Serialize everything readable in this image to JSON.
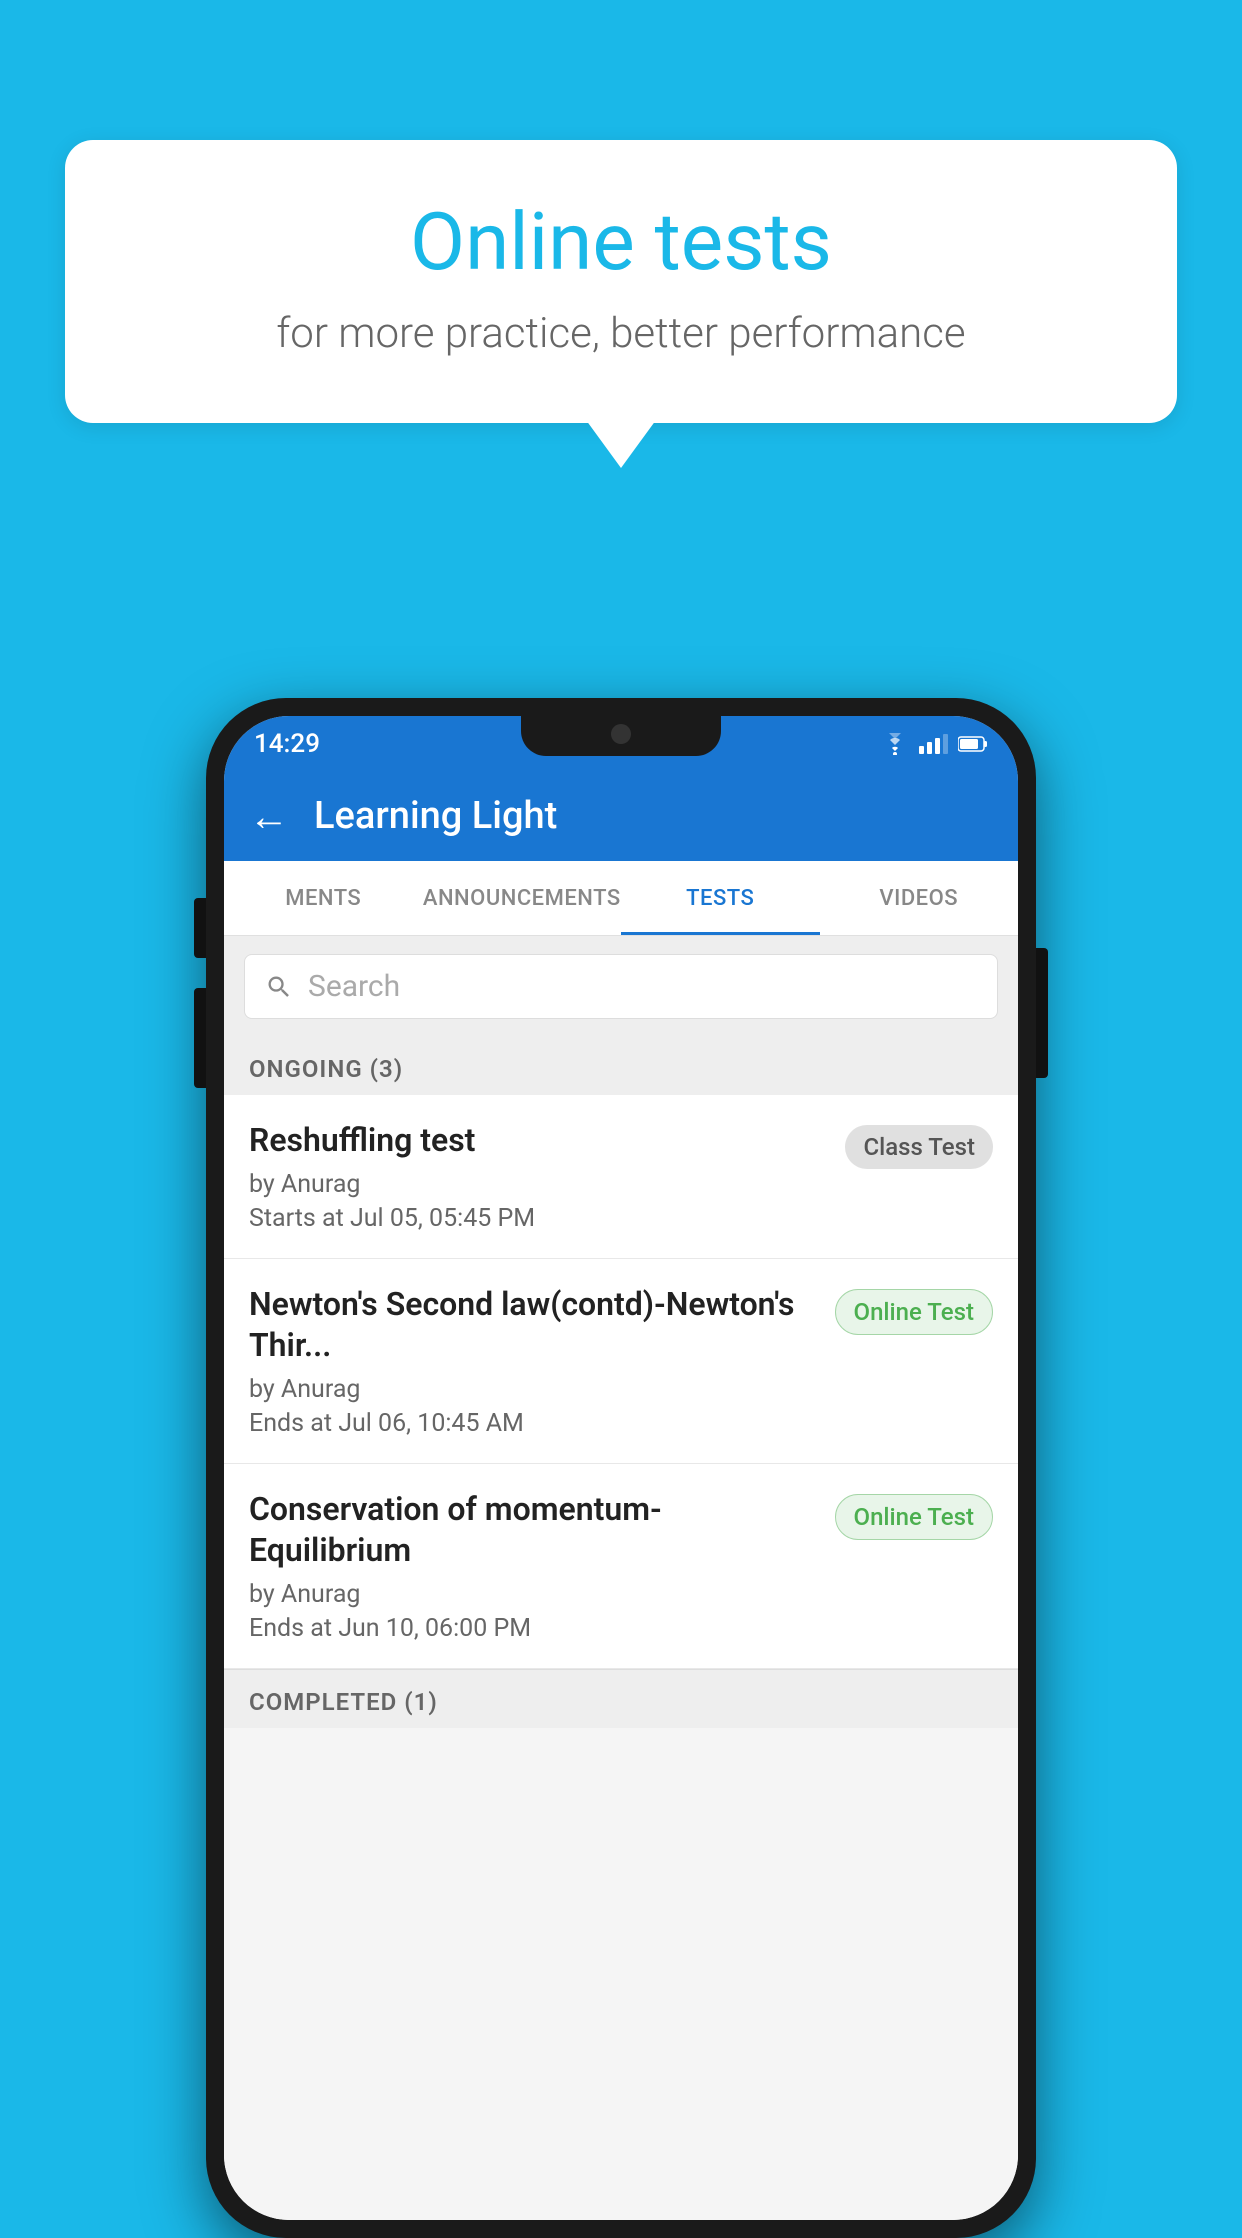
{
  "background_color": "#1ab8e8",
  "speech_bubble": {
    "title": "Online tests",
    "subtitle": "for more practice, better performance"
  },
  "phone": {
    "status_bar": {
      "time": "14:29",
      "wifi": "▼",
      "signal": "▲",
      "battery": "▌"
    },
    "app_bar": {
      "back_label": "←",
      "title": "Learning Light"
    },
    "tabs": [
      {
        "label": "MENTS",
        "active": false
      },
      {
        "label": "ANNOUNCEMENTS",
        "active": false
      },
      {
        "label": "TESTS",
        "active": true
      },
      {
        "label": "VIDEOS",
        "active": false
      }
    ],
    "search": {
      "placeholder": "Search"
    },
    "ongoing_section": {
      "header": "ONGOING (3)",
      "items": [
        {
          "title": "Reshuffling test",
          "by": "by Anurag",
          "time": "Starts at  Jul 05, 05:45 PM",
          "badge": "Class Test",
          "badge_type": "class"
        },
        {
          "title": "Newton's Second law(contd)-Newton's Thir...",
          "by": "by Anurag",
          "time": "Ends at  Jul 06, 10:45 AM",
          "badge": "Online Test",
          "badge_type": "online"
        },
        {
          "title": "Conservation of momentum-Equilibrium",
          "by": "by Anurag",
          "time": "Ends at  Jun 10, 06:00 PM",
          "badge": "Online Test",
          "badge_type": "online"
        }
      ]
    },
    "completed_section": {
      "header": "COMPLETED (1)"
    }
  }
}
